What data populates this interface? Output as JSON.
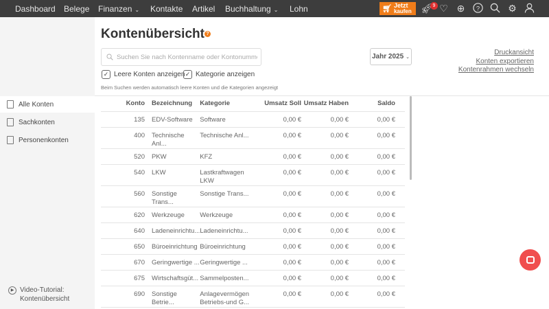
{
  "nav": {
    "items": [
      {
        "label": "Dashboard"
      },
      {
        "label": "Belege"
      },
      {
        "label": "Finanzen",
        "chev": "⌄"
      },
      {
        "label": "Kontakte"
      },
      {
        "label": "Artikel"
      },
      {
        "label": "Buchhaltung",
        "chev": "⌄"
      },
      {
        "label": "Lohn"
      }
    ],
    "buy_line1": "Jetzt",
    "buy_line2": "kaufen",
    "badge": "9"
  },
  "sidebar": {
    "items": [
      {
        "label": "Alle Konten"
      },
      {
        "label": "Sachkonten"
      },
      {
        "label": "Personenkonten"
      }
    ],
    "video_line1": "Video-Tutorial:",
    "video_line2": "Kontenübersicht"
  },
  "page": {
    "title": "Kontenübersicht",
    "help": "?",
    "search_placeholder": "Suchen Sie nach Kontenname oder Kontonummer",
    "year": "Jahr 2025",
    "links": [
      "Druckansicht",
      "Konten exportieren",
      "Kontenrahmen wechseln"
    ],
    "cb_empty": "Leere Konten anzeigen",
    "cb_category": "Kategorie anzeigen",
    "hint": "Beim Suchen werden automatisch leere Konten und die Kategorien angezeigt"
  },
  "table": {
    "headers": [
      "Konto",
      "Bezeichnung",
      "Kategorie",
      "Umsatz Soll",
      "Umsatz Haben",
      "Saldo"
    ],
    "rows": [
      [
        "135",
        "EDV-Software",
        "Software",
        "0,00 €",
        "0,00 €",
        "0,00 €"
      ],
      [
        "400",
        "Technische Anl...",
        "Technische Anl...",
        "0,00 €",
        "0,00 €",
        "0,00 €"
      ],
      [
        "520",
        "PKW",
        "KFZ",
        "0,00 €",
        "0,00 €",
        "0,00 €"
      ],
      [
        "540",
        "LKW",
        "Lastkraftwagen LKW",
        "0,00 €",
        "0,00 €",
        "0,00 €"
      ],
      [
        "560",
        "Sonstige Trans...",
        "Sonstige Trans...",
        "0,00 €",
        "0,00 €",
        "0,00 €"
      ],
      [
        "620",
        "Werkzeuge",
        "Werkzeuge",
        "0,00 €",
        "0,00 €",
        "0,00 €"
      ],
      [
        "640",
        "Ladeneinrichtu...",
        "Ladeneinrichtu...",
        "0,00 €",
        "0,00 €",
        "0,00 €"
      ],
      [
        "650",
        "Büroeinrichtung",
        "Büroeinrichtung",
        "0,00 €",
        "0,00 €",
        "0,00 €"
      ],
      [
        "670",
        "Geringwertige ...",
        "Geringwertige ...",
        "0,00 €",
        "0,00 €",
        "0,00 €"
      ],
      [
        "675",
        "Wirtschaftsgüt...",
        "Sammelposten...",
        "0,00 €",
        "0,00 €",
        "0,00 €"
      ],
      [
        "690",
        "Sonstige Betrie...",
        "Anlagevermögen Betriebs-und G...",
        "0,00 €",
        "0,00 €",
        "0,00 €"
      ]
    ]
  }
}
